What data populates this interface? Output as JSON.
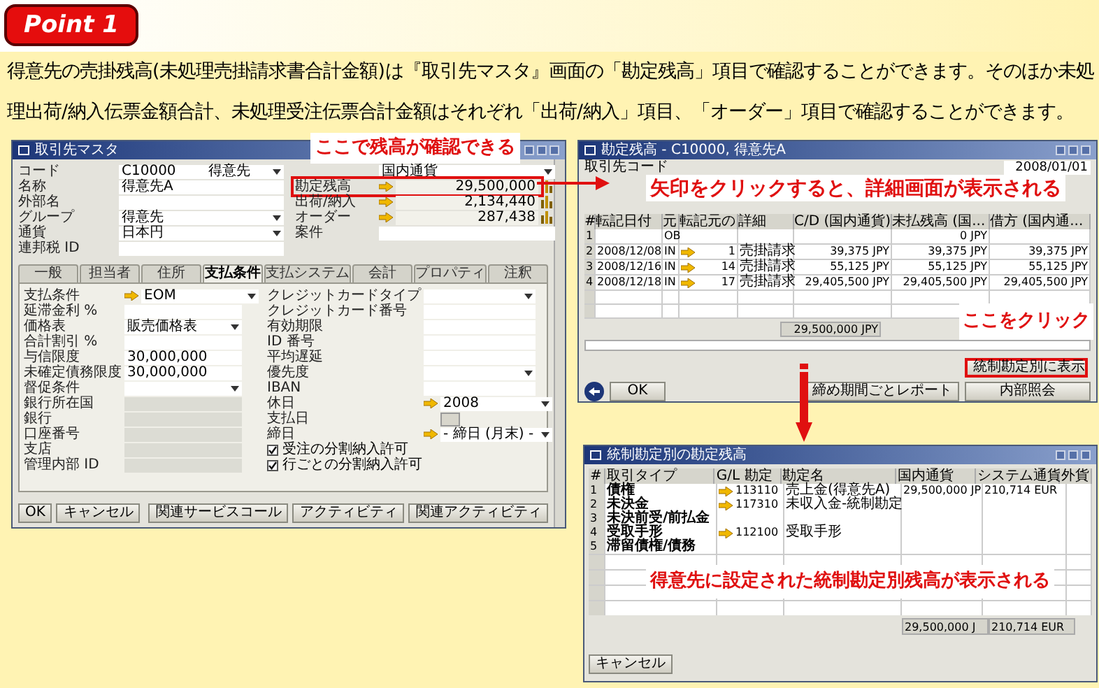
{
  "badge": "Point 1",
  "intro": "得意先の売掛残高(未処理売掛請求書合計金額)は『取引先マスタ』画面の「勘定残高」項目で確認することができます。そのほか未処理出荷/納入伝票金額合計、未処理受注伝票合計金額はそれぞれ「出荷/納入」項目、「オーダー」項目で確認することができます。",
  "master": {
    "title": "取引先マスタ",
    "header_left": [
      {
        "label": "コード",
        "kind": "code",
        "value": "C10000",
        "select_value": "得意先"
      },
      {
        "label": "名称",
        "kind": "text",
        "value": "得意先A"
      },
      {
        "label": "外部名",
        "kind": "text"
      },
      {
        "label": "グループ",
        "kind": "select",
        "value": "得意先"
      },
      {
        "label": "通貨",
        "kind": "select",
        "value": "日本円"
      },
      {
        "label": "連邦税 ID",
        "kind": "text"
      }
    ],
    "header_right": [
      {
        "kind": "select",
        "value": "国内通貨"
      },
      {
        "label": "勘定残高",
        "kind": "balance",
        "value": "29,500,000",
        "highlighted": true
      },
      {
        "label": "出荷/納入",
        "kind": "balance",
        "value": "2,134,440",
        "highlighted": false
      },
      {
        "label": "オーダー",
        "kind": "balance",
        "value": "287,438",
        "highlighted": false
      },
      {
        "label": "案件",
        "kind": "text"
      }
    ],
    "tabs": [
      {
        "label": "一般",
        "selected": false
      },
      {
        "label": "担当者",
        "selected": false
      },
      {
        "label": "住所",
        "selected": false
      },
      {
        "label": "支払条件",
        "selected": true
      },
      {
        "label": "支払システム",
        "selected": false
      },
      {
        "label": "会計",
        "selected": false
      },
      {
        "label": "プロパティ",
        "selected": false
      },
      {
        "label": "注釈",
        "selected": false
      }
    ],
    "payment_left": [
      {
        "label": "支払条件",
        "kind": "link_select",
        "value": "EOM"
      },
      {
        "label": "延滞金利 %",
        "kind": "text"
      },
      {
        "label": "価格表",
        "kind": "select",
        "value": "販売価格表"
      },
      {
        "label": "合計割引 %",
        "kind": "text"
      },
      {
        "label": "与信限度",
        "kind": "text",
        "value": "30,000,000"
      },
      {
        "label": "未確定債務限度",
        "kind": "text",
        "value": "30,000,000"
      },
      {
        "label": "督促条件",
        "kind": "select"
      },
      {
        "label": "銀行所在国",
        "kind": "disabled"
      },
      {
        "label": "銀行",
        "kind": "disabled"
      },
      {
        "label": "口座番号",
        "kind": "disabled"
      },
      {
        "label": "支店",
        "kind": "disabled"
      },
      {
        "label": "管理内部 ID",
        "kind": "disabled"
      }
    ],
    "payment_right": [
      {
        "label": "クレジットカードタイプ",
        "kind": "select"
      },
      {
        "label": "クレジットカード番号",
        "kind": "text"
      },
      {
        "label": "有効期限",
        "kind": "text"
      },
      {
        "label": "ID 番号",
        "kind": "text"
      },
      {
        "label": "平均遅延",
        "kind": "text"
      },
      {
        "label": "優先度",
        "kind": "select"
      },
      {
        "label": "IBAN",
        "kind": "text"
      },
      {
        "label": "休日",
        "kind": "link_select",
        "value": "2008"
      },
      {
        "label": "支払日",
        "kind": "picker"
      },
      {
        "label": "締日",
        "kind": "link_select",
        "value": "- 締日 (月末) -"
      }
    ],
    "checkboxes": [
      {
        "label": "受注の分割納入許可",
        "checked": true
      },
      {
        "label": "行ごとの分割納入許可",
        "checked": true
      }
    ],
    "buttons": [
      "OK",
      "キャンセル",
      "関連サービスコール",
      "アクティビティ",
      "関連アクティビティ"
    ]
  },
  "balance_window": {
    "title": "勘定残高 - C10000, 得意先A",
    "code_label": "取引先コード",
    "date": "2008/01/01",
    "columns": [
      "#",
      "転記日付",
      "元",
      "転記元の",
      "詳細",
      "C/D (国内通貨)",
      "未払残高 (国...",
      "借方 (国内通..."
    ],
    "rows": [
      {
        "link": false,
        "cells": [
          "1",
          "",
          "OB",
          "",
          "",
          "",
          "0 JPY",
          ""
        ]
      },
      {
        "link": true,
        "cells": [
          "2",
          "2008/12/08",
          "IN",
          "1",
          "売掛請求",
          "39,375 JPY",
          "39,375 JPY",
          "39,375 JPY"
        ]
      },
      {
        "link": true,
        "cells": [
          "3",
          "2008/12/16",
          "IN",
          "14",
          "売掛請求",
          "55,125 JPY",
          "55,125 JPY",
          "55,125 JPY"
        ]
      },
      {
        "link": true,
        "cells": [
          "4",
          "2008/12/18",
          "IN",
          "17",
          "売掛請求",
          "29,405,500 JPY",
          "29,405,500 JPY",
          "29,405,500 JPY"
        ]
      }
    ],
    "total": "29,500,000 JPY",
    "buttons": [
      {
        "label": "統制勘定別に表示",
        "highlighted": true
      },
      {
        "label": "締め期間ごとレポート",
        "highlighted": false
      },
      {
        "label": "内部照会",
        "highlighted": false
      }
    ],
    "ok": "OK"
  },
  "control_window": {
    "title": "統制勘定別の勘定残高",
    "columns": [
      "#",
      "取引タイプ",
      "G/L 勘定",
      "勘定名",
      "国内通貨",
      "システム通貨",
      "外貨"
    ],
    "rows": [
      {
        "link": true,
        "cells": [
          "1",
          "債権",
          "113110",
          "売上金(得意先A)",
          "29,500,000 JP",
          "210,714 EUR",
          ""
        ]
      },
      {
        "link": true,
        "cells": [
          "2",
          "未決金",
          "117310",
          "未収入金-統制勘定",
          "",
          "",
          ""
        ]
      },
      {
        "link": false,
        "cells": [
          "3",
          "未決前受/前払金",
          "",
          "",
          "",
          "",
          ""
        ]
      },
      {
        "link": true,
        "cells": [
          "4",
          "受取手形",
          "112100",
          "受取手形",
          "",
          "",
          ""
        ]
      },
      {
        "link": false,
        "cells": [
          "5",
          "滞留債権/債務",
          "",
          "",
          "",
          "",
          ""
        ]
      }
    ],
    "totals": [
      "29,500,000 J",
      "210,714 EUR"
    ],
    "cancel": "キャンセル"
  },
  "callouts": [
    "ここで残高が確認できる",
    "矢印をクリックすると、詳細画面が表示される",
    "ここをクリック",
    "得意先に設定された統制勘定別残高が表示される"
  ]
}
